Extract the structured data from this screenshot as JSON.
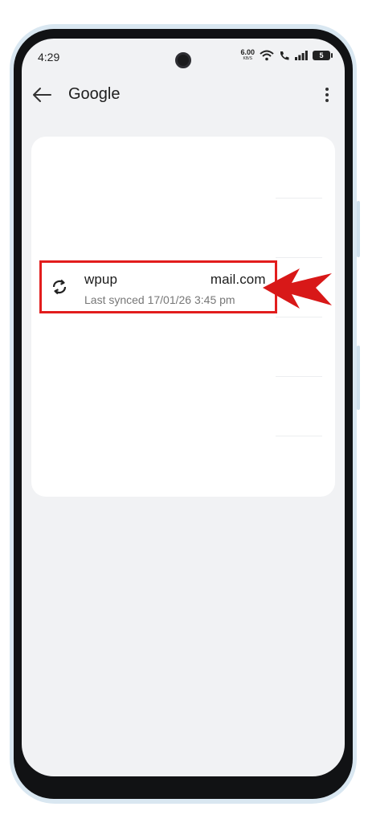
{
  "status_bar": {
    "time": "4:29",
    "net_speed": "6.00",
    "net_unit": "KB/S",
    "battery": "5"
  },
  "app_bar": {
    "title": "Google"
  },
  "account": {
    "email_prefix": "wpup",
    "email_suffix": "mail.com",
    "last_synced": "Last synced 17/01/26 3:45 pm"
  },
  "annotation": {
    "highlight_color": "#e21d1d",
    "arrow_color": "#d81818"
  }
}
